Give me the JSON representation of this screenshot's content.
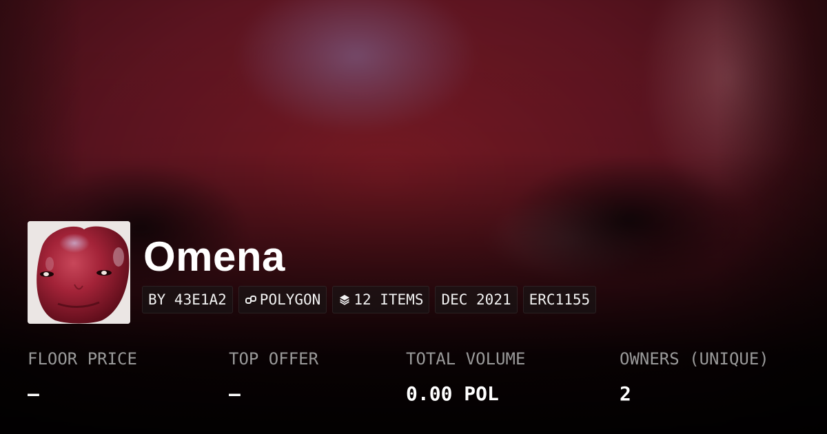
{
  "collection": {
    "name": "Omena",
    "avatar_alt": "apple-face-avatar"
  },
  "tags": [
    {
      "label": "BY 43E1A2",
      "icon": ""
    },
    {
      "label": "POLYGON",
      "icon": "chain-link-icon"
    },
    {
      "label": "12 ITEMS",
      "icon": "layers-icon"
    },
    {
      "label": "DEC 2021",
      "icon": ""
    },
    {
      "label": "ERC1155",
      "icon": ""
    }
  ],
  "stats": [
    {
      "label": "FLOOR PRICE",
      "value": "—"
    },
    {
      "label": "TOP OFFER",
      "value": "—"
    },
    {
      "label": "TOTAL VOLUME",
      "value": "0.00 POL"
    },
    {
      "label": "OWNERS (UNIQUE)",
      "value": "2"
    }
  ],
  "colors": {
    "background_dark": "#0c0406",
    "hero_red": "#7a1a24",
    "label_gray": "#9a9a9a",
    "text_white": "#ffffff"
  }
}
